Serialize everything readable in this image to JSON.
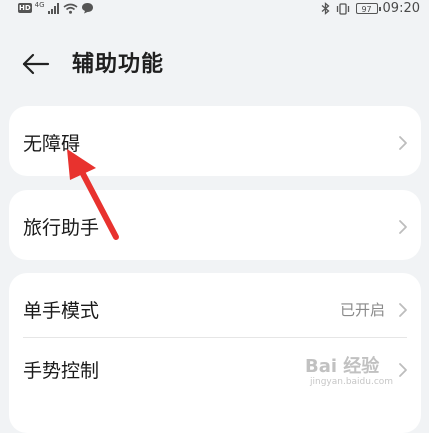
{
  "status_bar": {
    "hd": "HD",
    "network": "4G",
    "battery": "97",
    "time": "09:20"
  },
  "header": {
    "title": "辅助功能"
  },
  "cards": [
    {
      "rows": [
        {
          "label": "无障碍",
          "value": ""
        }
      ]
    },
    {
      "rows": [
        {
          "label": "旅行助手",
          "value": ""
        }
      ]
    },
    {
      "rows": [
        {
          "label": "单手模式",
          "value": "已开启"
        },
        {
          "label": "手势控制",
          "value": ""
        }
      ]
    }
  ],
  "icons": {
    "back": "back-arrow-icon",
    "chevron": "chevron-right-icon",
    "annotation": "red-arrow-annotation"
  },
  "colors": {
    "background": "#f1f3f5",
    "card": "#ffffff",
    "annotation_red": "#e8322e"
  },
  "watermark": {
    "text": "Bai 经验",
    "sub": "jingyan.baidu.com"
  }
}
